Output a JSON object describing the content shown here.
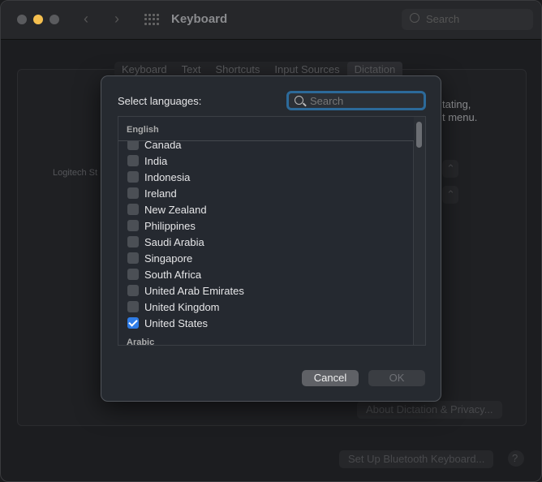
{
  "window": {
    "title": "Keyboard",
    "search_placeholder": "Search"
  },
  "tabs": [
    {
      "label": "Keyboard"
    },
    {
      "label": "Text"
    },
    {
      "label": "Shortcuts"
    },
    {
      "label": "Input Sources"
    },
    {
      "label": "Dictation",
      "selected": true
    }
  ],
  "background": {
    "mic_label_fragment": "Logitech St",
    "desc_fragment_1": "tating,",
    "desc_fragment_2": "t menu.",
    "about_button": "About Dictation & Privacy...",
    "bluetooth_button": "Set Up Bluetooth Keyboard...",
    "help": "?"
  },
  "dialog": {
    "label": "Select languages:",
    "search_placeholder": "Search",
    "groups": [
      {
        "name": "English",
        "items": [
          {
            "label": "Canada",
            "checked": false
          },
          {
            "label": "India",
            "checked": false
          },
          {
            "label": "Indonesia",
            "checked": false
          },
          {
            "label": "Ireland",
            "checked": false
          },
          {
            "label": "New Zealand",
            "checked": false
          },
          {
            "label": "Philippines",
            "checked": false
          },
          {
            "label": "Saudi Arabia",
            "checked": false
          },
          {
            "label": "Singapore",
            "checked": false
          },
          {
            "label": "South Africa",
            "checked": false
          },
          {
            "label": "United Arab Emirates",
            "checked": false
          },
          {
            "label": "United Kingdom",
            "checked": false
          },
          {
            "label": "United States",
            "checked": true
          }
        ]
      },
      {
        "name": "Arabic",
        "items": []
      }
    ],
    "cancel": "Cancel",
    "ok": "OK"
  },
  "colors": {
    "accent": "#2f7ce6",
    "focus_ring": "#2c6a9a"
  }
}
